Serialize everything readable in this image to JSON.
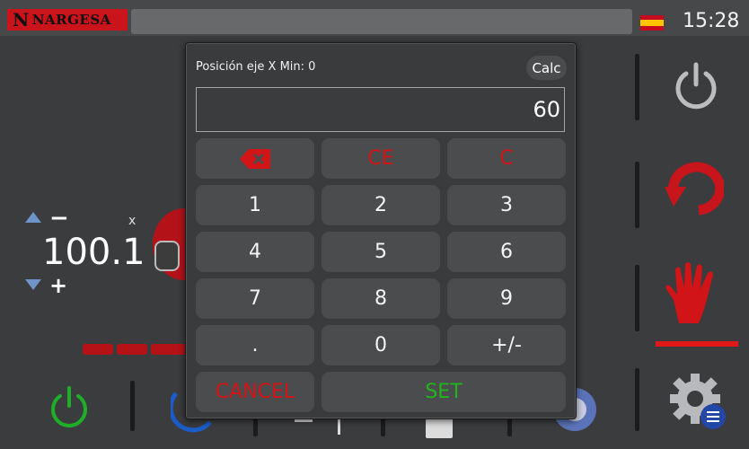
{
  "brand": {
    "name": "NARGESA",
    "mark": "N"
  },
  "status": {
    "time": "15:28",
    "language_flag": "spain-flag-icon"
  },
  "axis": {
    "label": "x",
    "position": "100.1",
    "decrease": "−",
    "increase": "+"
  },
  "dialog": {
    "title": "Posición eje X Min: 0",
    "calc_label": "Calc",
    "display_value": "60",
    "keys": {
      "ce": "CE",
      "c": "C",
      "k1": "1",
      "k2": "2",
      "k3": "3",
      "k4": "4",
      "k5": "5",
      "k6": "6",
      "k7": "7",
      "k8": "8",
      "k9": "9",
      "dot": ".",
      "k0": "0",
      "sign": "+/-",
      "cancel": "CANCEL",
      "set": "SET"
    }
  },
  "colors": {
    "accent_red": "#d41518",
    "accent_green": "#22b41e",
    "panel": "#3b3c3e",
    "key": "#4b4c4e"
  },
  "icons": {
    "power_right": "power-icon",
    "refresh": "refresh-icon",
    "stop": "hand-stop-icon",
    "settings": "gear-icon",
    "power_bottom": "power-icon",
    "backspace": "backspace-icon"
  }
}
